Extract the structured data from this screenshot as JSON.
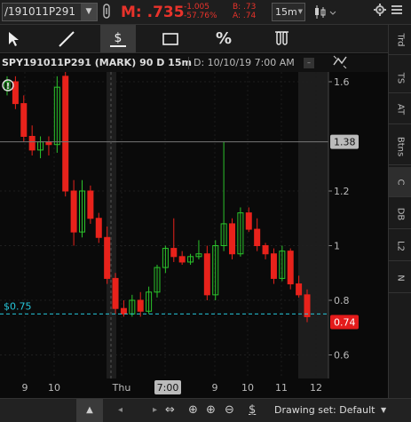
{
  "topbar": {
    "symbol": "/191011P291",
    "mark_price": "M: .735",
    "net_change": "-1.005",
    "pct_change": "-57.76%",
    "bid": "B: .73",
    "ask": "A: .74",
    "aggregation": "15m"
  },
  "tools": [
    "cursor",
    "line",
    "price-level",
    "rectangle",
    "percent",
    "fibonacci"
  ],
  "tool_percent_label": "%",
  "side_tabs": [
    "Trd",
    "TS",
    "AT",
    "Btns",
    "C",
    "DB",
    "L2",
    "N"
  ],
  "header": {
    "title": "SPY191011P291 (MARK) 90 D 15m",
    "date": "D: 10/10/19 7:00 AM"
  },
  "chart_data": {
    "type": "candlestick",
    "y_ticks": [
      "1.6",
      "1.38",
      "1.2",
      "1",
      "0.8",
      "0.74",
      "0.6"
    ],
    "y_range": [
      0.5,
      1.6
    ],
    "x_ticks": [
      "9",
      "10",
      "Thu",
      "7:00",
      "9",
      "10",
      "11",
      "12"
    ],
    "last_price_label": "0.74",
    "horizontal_line_label": "$0.75",
    "crosshair_price_label": "1.38",
    "crosshair_time_label": "7:00",
    "candles": [
      {
        "o": 1.57,
        "h": 1.62,
        "l": 1.55,
        "c": 1.6
      },
      {
        "o": 1.6,
        "h": 1.62,
        "l": 1.5,
        "c": 1.52
      },
      {
        "o": 1.52,
        "h": 1.55,
        "l": 1.38,
        "c": 1.4
      },
      {
        "o": 1.4,
        "h": 1.44,
        "l": 1.33,
        "c": 1.35
      },
      {
        "o": 1.35,
        "h": 1.4,
        "l": 1.32,
        "c": 1.38
      },
      {
        "o": 1.38,
        "h": 1.4,
        "l": 1.33,
        "c": 1.37
      },
      {
        "o": 1.37,
        "h": 1.62,
        "l": 1.34,
        "c": 1.58
      },
      {
        "o": 1.62,
        "h": 1.64,
        "l": 1.18,
        "c": 1.2
      },
      {
        "o": 1.2,
        "h": 1.24,
        "l": 1.0,
        "c": 1.05
      },
      {
        "o": 1.05,
        "h": 1.24,
        "l": 1.03,
        "c": 1.2
      },
      {
        "o": 1.2,
        "h": 1.22,
        "l": 1.08,
        "c": 1.1
      },
      {
        "o": 1.1,
        "h": 1.12,
        "l": 1.01,
        "c": 1.03
      },
      {
        "o": 1.03,
        "h": 1.07,
        "l": 0.86,
        "c": 0.88
      },
      {
        "o": 0.88,
        "h": 0.9,
        "l": 0.75,
        "c": 0.77
      },
      {
        "o": 0.77,
        "h": 0.8,
        "l": 0.74,
        "c": 0.75
      },
      {
        "o": 0.75,
        "h": 0.82,
        "l": 0.74,
        "c": 0.8
      },
      {
        "o": 0.8,
        "h": 0.83,
        "l": 0.74,
        "c": 0.76
      },
      {
        "o": 0.76,
        "h": 0.85,
        "l": 0.75,
        "c": 0.83
      },
      {
        "o": 0.83,
        "h": 0.93,
        "l": 0.81,
        "c": 0.92
      },
      {
        "o": 0.92,
        "h": 1.0,
        "l": 0.9,
        "c": 0.99
      },
      {
        "o": 0.99,
        "h": 1.1,
        "l": 0.94,
        "c": 0.96
      },
      {
        "o": 0.96,
        "h": 0.98,
        "l": 0.93,
        "c": 0.94
      },
      {
        "o": 0.94,
        "h": 0.97,
        "l": 0.93,
        "c": 0.96
      },
      {
        "o": 0.96,
        "h": 1.02,
        "l": 0.95,
        "c": 0.97
      },
      {
        "o": 0.97,
        "h": 1.0,
        "l": 0.8,
        "c": 0.82
      },
      {
        "o": 0.82,
        "h": 1.02,
        "l": 0.8,
        "c": 1.0
      },
      {
        "o": 1.0,
        "h": 1.38,
        "l": 0.98,
        "c": 1.08
      },
      {
        "o": 1.08,
        "h": 1.1,
        "l": 0.95,
        "c": 0.97
      },
      {
        "o": 0.97,
        "h": 1.14,
        "l": 0.96,
        "c": 1.12
      },
      {
        "o": 1.12,
        "h": 1.14,
        "l": 1.05,
        "c": 1.06
      },
      {
        "o": 1.06,
        "h": 1.1,
        "l": 0.98,
        "c": 1.0
      },
      {
        "o": 1.0,
        "h": 1.01,
        "l": 0.95,
        "c": 0.97
      },
      {
        "o": 0.97,
        "h": 0.99,
        "l": 0.86,
        "c": 0.88
      },
      {
        "o": 0.88,
        "h": 1.0,
        "l": 0.87,
        "c": 0.98
      },
      {
        "o": 0.98,
        "h": 0.99,
        "l": 0.84,
        "c": 0.86
      },
      {
        "o": 0.86,
        "h": 0.89,
        "l": 0.81,
        "c": 0.82
      },
      {
        "o": 0.82,
        "h": 0.84,
        "l": 0.72,
        "c": 0.74
      }
    ]
  },
  "bottombar": {
    "drawing_set": "Drawing set: Default"
  },
  "colors": {
    "up": "#2bc42b",
    "down": "#e8221b",
    "cyan": "#26c6da",
    "background": "#0a0a0a"
  }
}
